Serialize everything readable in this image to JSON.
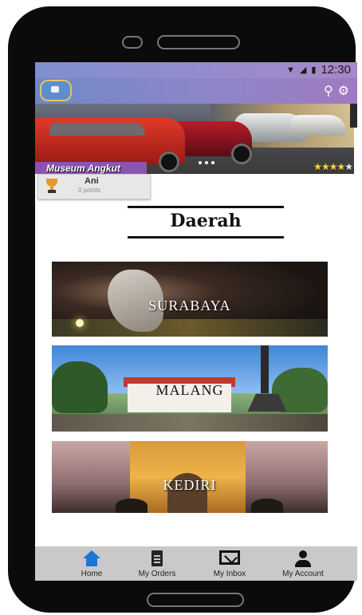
{
  "status_bar": {
    "time": "12:30"
  },
  "app_bar": {
    "search_icon": "search-icon",
    "settings_icon": "gear-icon"
  },
  "hero": {
    "title": "Museum Angkut",
    "rating": 4,
    "rating_max": 5,
    "slide_count": 3
  },
  "user": {
    "name": "Ani",
    "points": "0 points"
  },
  "section": {
    "title": "Daerah"
  },
  "regions": [
    {
      "label": "SURABAYA"
    },
    {
      "label": "MALANG"
    },
    {
      "label": "KEDIRI"
    }
  ],
  "bottom_nav": [
    {
      "label": "Home",
      "icon": "home-icon",
      "active": true,
      "color": "#1976d2"
    },
    {
      "label": "My Orders",
      "icon": "document-icon"
    },
    {
      "label": "My Inbox",
      "icon": "mail-icon"
    },
    {
      "label": "My Account",
      "icon": "person-icon"
    }
  ]
}
